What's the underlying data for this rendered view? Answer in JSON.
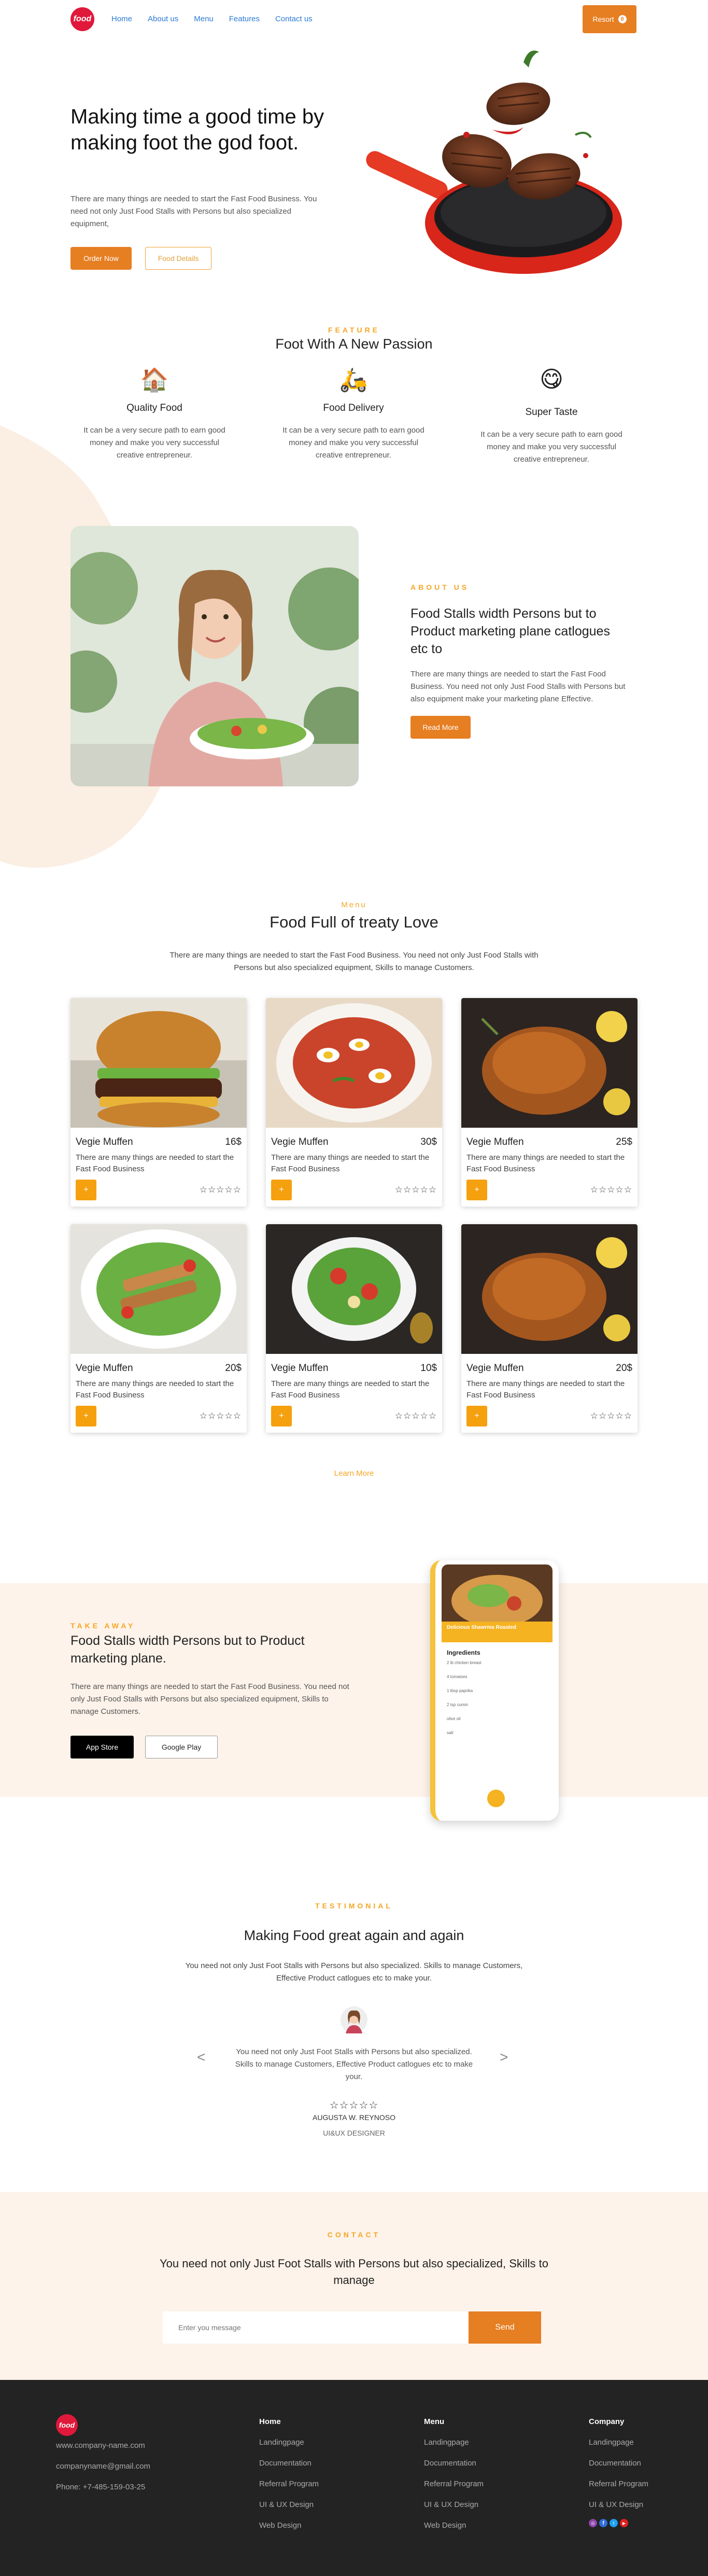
{
  "nav": {
    "logo": "food",
    "links": [
      "Home",
      "About us",
      "Menu",
      "Features",
      "Contact us"
    ],
    "cta": "Resort",
    "cta_count": "0"
  },
  "hero": {
    "title": "Making time a good time by making foot the god foot.",
    "text": "There are many things are needed to start the Fast Food Business. You need not only Just Food Stalls with Persons but also specialized equipment,",
    "order_button": "Order Now",
    "details_button": "Food Details"
  },
  "feature": {
    "eyebrow": "FEATURE",
    "title": "Foot With A New Passion",
    "items": [
      {
        "icon": "🏠",
        "title": "Quality Food",
        "text": "It can be a very secure path to earn good money and make you very successful creative entrepreneur."
      },
      {
        "icon": "🛵",
        "title": "Food Delivery",
        "text": "It can be a very secure path to earn good money and make you very successful creative entrepreneur."
      },
      {
        "icon": "😋",
        "title": "Super Taste",
        "text": "It can be a very secure path to earn good money and make you very successful creative entrepreneur."
      }
    ]
  },
  "about": {
    "eyebrow": "ABOUT US",
    "title": "Food Stalls width Persons but to Product marketing plane catlogues etc to",
    "text": "There are many things are needed to start the Fast Food Business. You need not only Just Food Stalls with Persons but also equipment make your marketing plane Effective.",
    "button": "Read More"
  },
  "menu": {
    "eyebrow": "Menu",
    "title": "Food Full of treaty Love",
    "text": "There are many things are needed to start the Fast Food Business. You need not only Just Food Stalls with Persons but also specialized equipment, Skills to manage Customers.",
    "cards": [
      {
        "name": "Vegie Muffen",
        "price": "16$",
        "desc": "There are many things are needed to start the Fast Food Business",
        "stars": "☆☆☆☆☆",
        "plus": "+"
      },
      {
        "name": "Vegie Muffen",
        "price": "30$",
        "desc": "There are many things are needed to start the Fast Food Business",
        "stars": "☆☆☆☆☆",
        "plus": "+"
      },
      {
        "name": "Vegie Muffen",
        "price": "25$",
        "desc": "There are many things are needed to start the Fast Food Business",
        "stars": "☆☆☆☆☆",
        "plus": "+"
      },
      {
        "name": "Vegie Muffen",
        "price": "20$",
        "desc": "There are many things are needed to start the Fast Food Business",
        "stars": "☆☆☆☆☆",
        "plus": "+"
      },
      {
        "name": "Vegie Muffen",
        "price": "10$",
        "desc": "There are many things are needed to start the Fast Food Business",
        "stars": "☆☆☆☆☆",
        "plus": "+"
      },
      {
        "name": "Vegie Muffen",
        "price": "20$",
        "desc": "There are many things are needed to start the Fast Food Business",
        "stars": "☆☆☆☆☆",
        "plus": "+"
      }
    ],
    "learn_more": "Learn More"
  },
  "takeaway": {
    "eyebrow": "TAKE AWAY",
    "title": "Food Stalls width Persons but to Product marketing plane.",
    "text": "There are many things are needed to start the Fast Food Business. You need not only Just Food Stalls with Persons but also specialized equipment, Skills to manage Customers.",
    "app_store": "App Store",
    "google_play": "Google Play",
    "phone": {
      "card_title": "Delicious Shawrma Roasted",
      "ingredients_title": "Ingredients",
      "ingredients": [
        "2 lb chicken breast",
        "4 tomatoes",
        "1 tbsp paprika",
        "2 tsp cumin",
        "olive oil",
        "salt"
      ]
    }
  },
  "testimonial": {
    "eyebrow": "TESTIMONIAL",
    "title": "Making Food great again and again",
    "intro": "You need not only Just Foot Stalls with Persons but also specialized. Skills to manage Customers, Effective Product catlogues etc to make your.",
    "quote": "You need not only Just Foot Stalls with Persons but also specialized. Skills to manage Customers, Effective Product catlogues etc to make your.",
    "stars": "☆☆☆☆☆",
    "name": "AUGUSTA W. REYNOSO",
    "role": "UI&UX DESIGNER",
    "prev": "<",
    "next": ">"
  },
  "contact": {
    "eyebrow": "CONTACT",
    "title": "You need not only Just Foot Stalls with Persons but also specialized, Skills to manage",
    "placeholder": "Enter you message",
    "send": "Send"
  },
  "footer": {
    "logo": "food",
    "contacts": [
      "www.company-name.com",
      "companyname@gmail.com",
      "Phone: +7-485-159-03-25"
    ],
    "columns": [
      {
        "title": "Home",
        "links": [
          "Landingpage",
          "Documentation",
          "Referral Program",
          "UI & UX Design",
          "Web Design"
        ]
      },
      {
        "title": "Menu",
        "links": [
          "Landingpage",
          "Documentation",
          "Referral Program",
          "UI & UX Design",
          "Web Design"
        ]
      },
      {
        "title": "Company",
        "links": [
          "Landingpage",
          "Documentation",
          "Referral Program",
          "UI & UX Design"
        ]
      }
    ],
    "social_colors": [
      "#8e44ad",
      "#2f6fdb",
      "#1da1f2",
      "#e02020"
    ]
  }
}
